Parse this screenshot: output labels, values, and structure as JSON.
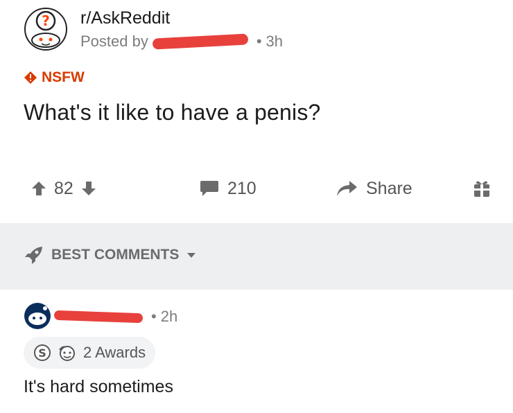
{
  "post": {
    "subreddit": "r/AskReddit",
    "posted_prefix": "Posted by",
    "age": "3h",
    "nsfw_label": "NSFW",
    "title": "What's it like to have a penis?"
  },
  "actions": {
    "votes": "82",
    "comments": "210",
    "share_label": "Share"
  },
  "sort": {
    "label": "BEST COMMENTS"
  },
  "comment": {
    "age": "2h",
    "awards_label": "2 Awards",
    "body": "It's hard sometimes"
  },
  "colors": {
    "nsfw": "#d93a00",
    "redaction": "#e8413c",
    "sortbar_bg": "#edeff1",
    "muted_text": "#7c7c7c"
  },
  "icons": [
    "subreddit-avatar-icon",
    "nsfw-icon",
    "upvote-icon",
    "downvote-icon",
    "comment-icon",
    "share-icon",
    "gift-icon",
    "rocket-icon",
    "chevron-down-icon",
    "user-avatar-icon",
    "silver-award-icon",
    "helpful-award-icon"
  ]
}
